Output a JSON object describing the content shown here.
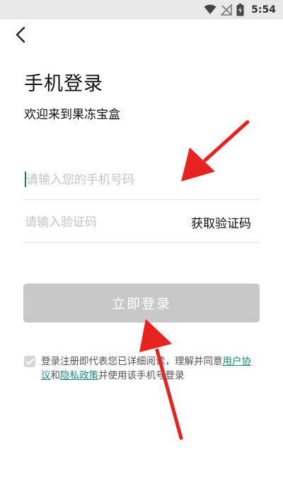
{
  "status_bar": {
    "time": "5:54",
    "icons": [
      "wifi-icon",
      "no-signal-icon",
      "battery-charging-icon"
    ]
  },
  "header": {
    "back_icon": "chevron-left-icon"
  },
  "title": "手机登录",
  "subtitle": "欢迎来到果冻宝盒",
  "phone_field": {
    "placeholder": "请输入您的手机号码",
    "value": ""
  },
  "code_field": {
    "placeholder": "请输入验证码",
    "value": ""
  },
  "get_code_label": "获取验证码",
  "login_button_label": "立即登录",
  "agreement": {
    "checked": false,
    "text_before": "登录注册即代表您已详细阅读，理解并同意",
    "link_user_agreement": "用户协议",
    "text_and": "和",
    "link_privacy_policy": "隐私政策",
    "text_after": "并使用该手机号登录"
  },
  "colors": {
    "accent": "#1a8a80",
    "button_disabled": "#c8c8c8",
    "annotation_arrow": "#e8221e"
  }
}
